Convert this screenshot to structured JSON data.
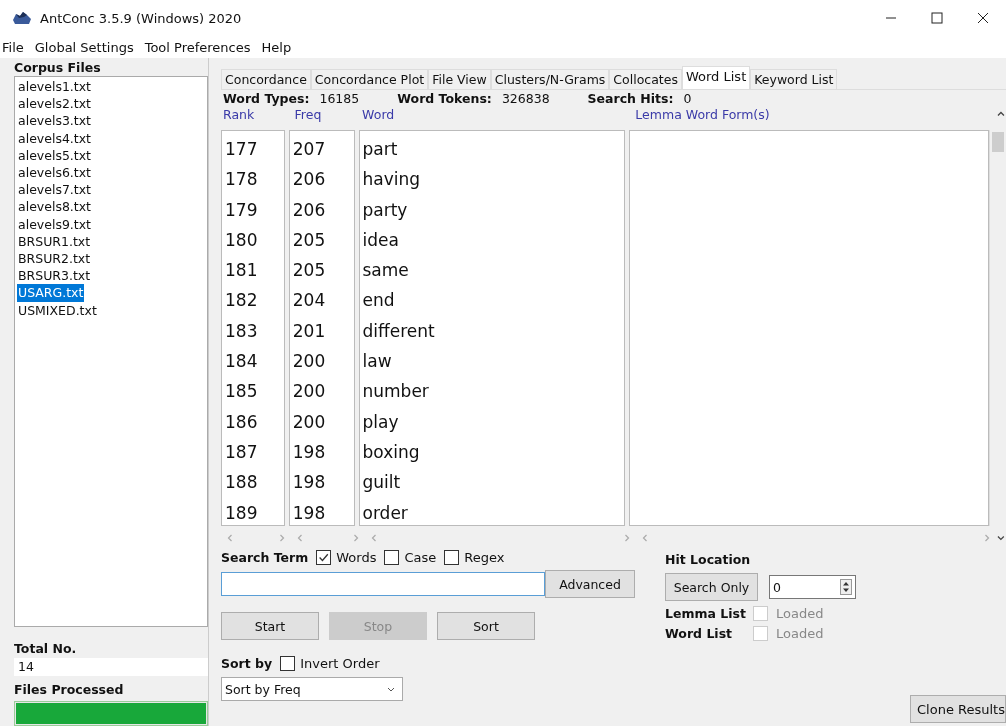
{
  "window": {
    "title": "AntConc 3.5.9 (Windows) 2020"
  },
  "menu": [
    "File",
    "Global Settings",
    "Tool Preferences",
    "Help"
  ],
  "corpus": {
    "label": "Corpus Files",
    "files": [
      {
        "name": "alevels1.txt",
        "selected": false
      },
      {
        "name": "alevels2.txt",
        "selected": false
      },
      {
        "name": "alevels3.txt",
        "selected": false
      },
      {
        "name": "alevels4.txt",
        "selected": false
      },
      {
        "name": "alevels5.txt",
        "selected": false
      },
      {
        "name": "alevels6.txt",
        "selected": false
      },
      {
        "name": "alevels7.txt",
        "selected": false
      },
      {
        "name": "alevels8.txt",
        "selected": false
      },
      {
        "name": "alevels9.txt",
        "selected": false
      },
      {
        "name": "BRSUR1.txt",
        "selected": false
      },
      {
        "name": "BRSUR2.txt",
        "selected": false
      },
      {
        "name": "BRSUR3.txt",
        "selected": false
      },
      {
        "name": "USARG.txt",
        "selected": true
      },
      {
        "name": "USMIXED.txt",
        "selected": false
      }
    ],
    "total_label": "Total No.",
    "total": "14",
    "processed_label": "Files Processed",
    "progress": {
      "level": 1
    }
  },
  "tabs": [
    {
      "label": "Concordance",
      "selected": false
    },
    {
      "label": "Concordance Plot",
      "selected": false
    },
    {
      "label": "File View",
      "selected": false
    },
    {
      "label": "Clusters/N-Grams",
      "selected": false
    },
    {
      "label": "Collocates",
      "selected": false
    },
    {
      "label": "Word List",
      "selected": true
    },
    {
      "label": "Keyword List",
      "selected": false
    }
  ],
  "stats": [
    {
      "label": "Word Types:",
      "value": "16185"
    },
    {
      "label": "Word Tokens:",
      "value": "326838"
    },
    {
      "label": "Search Hits:",
      "value": "0"
    }
  ],
  "table": {
    "columns": [
      "Rank",
      "Freq",
      "Word"
    ],
    "lemma_column": "Lemma Word Form(s)",
    "rows": [
      [
        "177",
        "207",
        "part"
      ],
      [
        "178",
        "206",
        "having"
      ],
      [
        "179",
        "206",
        "party"
      ],
      [
        "180",
        "205",
        "idea"
      ],
      [
        "181",
        "205",
        "same"
      ],
      [
        "182",
        "204",
        "end"
      ],
      [
        "183",
        "201",
        "different"
      ],
      [
        "184",
        "200",
        "law"
      ],
      [
        "185",
        "200",
        "number"
      ],
      [
        "186",
        "200",
        "play"
      ],
      [
        "187",
        "198",
        "boxing"
      ],
      [
        "188",
        "198",
        "guilt"
      ],
      [
        "189",
        "198",
        "order"
      ]
    ]
  },
  "search": {
    "label": "Search Term",
    "options": [
      {
        "label": "Words",
        "checked": true
      },
      {
        "label": "Case",
        "checked": false
      },
      {
        "label": "Regex",
        "checked": false
      }
    ],
    "advanced": "Advanced"
  },
  "buttons": [
    {
      "label": "Start",
      "disabled": false
    },
    {
      "label": "Stop",
      "disabled": true
    },
    {
      "label": "Sort",
      "disabled": false
    }
  ],
  "sort": {
    "label": "Sort by",
    "invert": {
      "label": "Invert Order",
      "checked": false
    },
    "value": "Sort by Freq"
  },
  "hit_location": {
    "label": "Hit Location",
    "button": "Search Only",
    "value": "0"
  },
  "lists": [
    {
      "label": "Lemma List",
      "option": "Loaded",
      "checked": false
    },
    {
      "label": "Word List",
      "option": "Loaded",
      "checked": false
    }
  ],
  "clone": "Clone Results"
}
